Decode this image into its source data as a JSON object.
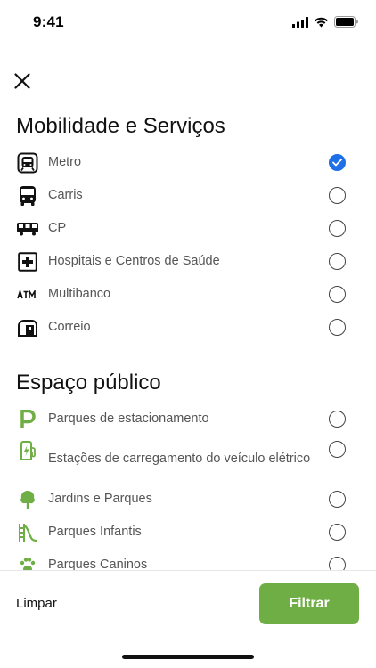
{
  "status_bar": {
    "time": "9:41"
  },
  "sections": [
    {
      "title": "Mobilidade e Serviços",
      "items": [
        {
          "label": "Metro",
          "icon": "metro-icon",
          "checked": true
        },
        {
          "label": "Carris",
          "icon": "bus-icon",
          "checked": false
        },
        {
          "label": "CP",
          "icon": "train-icon",
          "checked": false
        },
        {
          "label": "Hospitais e Centros de Saúde",
          "icon": "hospital-icon",
          "checked": false
        },
        {
          "label": "Multibanco",
          "icon": "atm-icon",
          "checked": false
        },
        {
          "label": "Correio",
          "icon": "mailbox-icon",
          "checked": false
        }
      ]
    },
    {
      "title": "Espaço público",
      "items": [
        {
          "label": "Parques de estacionamento",
          "icon": "parking-icon",
          "checked": false
        },
        {
          "label": "Estações de carregamento do veículo elétrico",
          "icon": "ev-charging-icon",
          "checked": false
        },
        {
          "label": "Jardins e Parques",
          "icon": "tree-icon",
          "checked": false
        },
        {
          "label": "Parques Infantis",
          "icon": "playground-icon",
          "checked": false
        },
        {
          "label": "Parques Caninos",
          "icon": "dog-park-icon",
          "checked": false
        }
      ]
    }
  ],
  "footer": {
    "clear_label": "Limpar",
    "filter_label": "Filtrar"
  },
  "colors": {
    "accent_green": "#6fae44",
    "check_blue": "#1e6fe8",
    "icon_green": "#6fae44"
  }
}
